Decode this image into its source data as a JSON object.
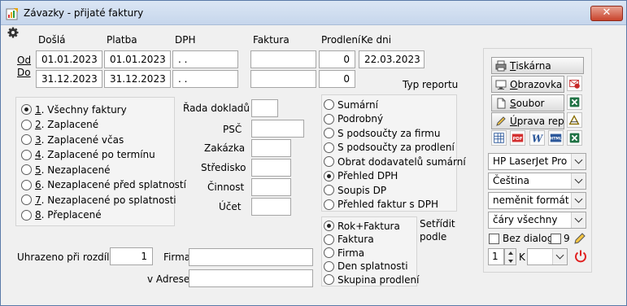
{
  "window": {
    "title": "Závazky - přijaté faktury",
    "close_label": "✕"
  },
  "colors": {
    "accent": "#2b579a",
    "excel_green": "#1f7244",
    "pdf_red": "#d32f2f",
    "power_red": "#e02020"
  },
  "headers": {
    "dosla": "Došlá",
    "platba": "Platba",
    "dph": "DPH",
    "faktura": "Faktura",
    "prodleni": "Prodlení",
    "ke_dni": "Ke dni"
  },
  "rows": {
    "od_label": "Od",
    "do_label": "Do",
    "od": {
      "dosla": "01.01.2023",
      "platba": "01.01.2023",
      "dph": " . .",
      "faktura": "",
      "prodleni": "0",
      "ke_dni": "22.03.2023"
    },
    "do": {
      "dosla": "31.12.2023",
      "platba": "31.12.2023",
      "dph": " . .",
      "faktura": "",
      "prodleni": "0"
    }
  },
  "typ_reportu_label": "Typ reportu",
  "filter_options": [
    {
      "num": "1",
      "label": ". Všechny faktury",
      "selected": true
    },
    {
      "num": "2",
      "label": ". Zaplacené",
      "selected": false
    },
    {
      "num": "3",
      "label": ". Zaplacené včas",
      "selected": false
    },
    {
      "num": "4",
      "label": ". Zaplacené po termínu",
      "selected": false
    },
    {
      "num": "5",
      "label": ". Nezaplacené",
      "selected": false
    },
    {
      "num": "6",
      "label": ". Nezaplacené před splatností",
      "selected": false
    },
    {
      "num": "7",
      "label": ". Nezaplacené po splatnosti",
      "selected": false
    },
    {
      "num": "8",
      "label": ". Přeplacené",
      "selected": false
    }
  ],
  "fields": {
    "rada_dokladu": {
      "label": "Řada dokladů",
      "value": ""
    },
    "psc": {
      "label": "PSČ",
      "value": ""
    },
    "zakazka": {
      "label": "Zakázka",
      "value": ""
    },
    "stredisko": {
      "label": "Středisko",
      "value": ""
    },
    "cinnost": {
      "label": "Činnost",
      "value": ""
    },
    "ucet": {
      "label": "Účet",
      "value": ""
    }
  },
  "report_types": [
    {
      "label": "Sumární",
      "selected": false
    },
    {
      "label": "Podrobný",
      "selected": false
    },
    {
      "label": "S podsoučty za firmu",
      "selected": false
    },
    {
      "label": "S podsoučty za prodlení",
      "selected": false
    },
    {
      "label": "Obrat dodavatelů sumární",
      "selected": false
    },
    {
      "label": "Přehled DPH",
      "selected": true
    },
    {
      "label": "Soupis DP",
      "selected": false
    },
    {
      "label": "Přehled faktur s DPH",
      "selected": false
    }
  ],
  "sort_label_1": "Setřídit",
  "sort_label_2": "podle",
  "sort_options": [
    {
      "label": "Rok+Faktura",
      "selected": true
    },
    {
      "label": "Faktura",
      "selected": false
    },
    {
      "label": "Firma",
      "selected": false
    },
    {
      "label": "Den splatnosti",
      "selected": false
    },
    {
      "label": "Skupina prodlení",
      "selected": false
    }
  ],
  "bottom": {
    "uhrazeno_label": "Uhrazeno při rozdílu",
    "uhrazeno_value": "1",
    "firma_label": "Firma",
    "firma_value": "",
    "vadrese_label": "v Adrese",
    "vadrese_value": ""
  },
  "output": {
    "tiskarna_u": "T",
    "tiskarna_rest": "iskárna",
    "obrazovka_u": "O",
    "obrazovka_rest": "brazovka",
    "soubor_u": "S",
    "soubor_rest": "oubor",
    "uprava_u": "Ú",
    "uprava_rest": "prava repor",
    "export_icons": [
      "table-icon",
      "pdf-icon",
      "word-icon",
      "html-icon",
      "excel-icon"
    ],
    "pdf_text": "PDF",
    "word_text": "W",
    "html_text": "HTML",
    "printer_select": "HP LaserJet Pro MFP",
    "language_select": "Čeština",
    "format_select": "neměnit formát",
    "lines_select": "čáry všechny",
    "bez_dialogu_label": "Bez dialogu",
    "bez_dialogu_checked": false,
    "nine_label": "9",
    "nine_checked": false,
    "copies": "1",
    "k_label": "K",
    "k_select": ""
  }
}
